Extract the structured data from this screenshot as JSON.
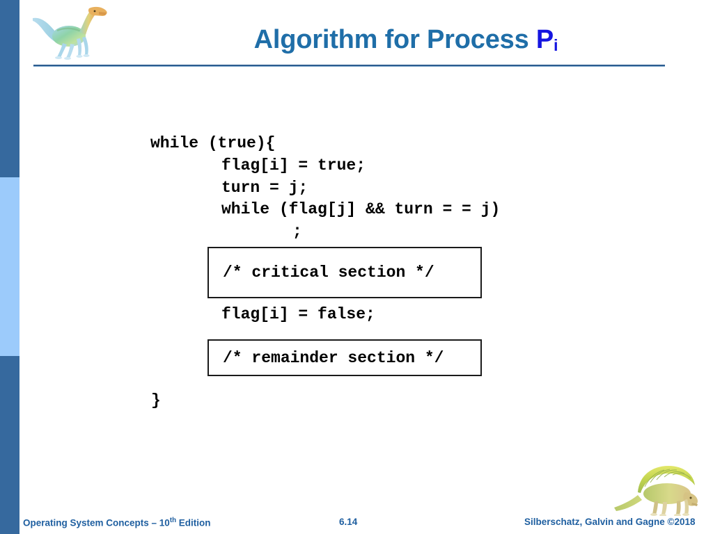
{
  "slide": {
    "title_main": "Algorithm for Process ",
    "title_var": "P",
    "title_var_sub": "i",
    "title_color": "#1f6ea8",
    "title_var_color": "#1515e0",
    "rule_color": "#2c5d8f"
  },
  "sidebar": {
    "segments": [
      {
        "name": "top",
        "color": "#36699e"
      },
      {
        "name": "middle",
        "color": "#9ccbfb"
      },
      {
        "name": "bottom",
        "color": "#36699e"
      }
    ]
  },
  "decorations": {
    "top_dinosaur": "ornithomimid-dinosaur-illustration",
    "bottom_dinosaur": "dimetrodon-dinosaur-illustration"
  },
  "code": {
    "line_while_true": "while (true){",
    "line_flag_true": "flag[i] = true;",
    "line_turn_j": "turn = j;",
    "line_while_flagj": "while (flag[j] && turn = = j)",
    "line_semicolon": ";",
    "line_flag_false": "flag[i] = false;",
    "line_close_brace": "}"
  },
  "boxes": {
    "critical_section": "/* critical section */",
    "remainder_section": "/* remainder section */"
  },
  "footer": {
    "left_prefix": "Operating System Concepts – 10",
    "left_sup": "th",
    "left_suffix": " Edition",
    "slide_number": "6.14",
    "right": "Silberschatz, Galvin and Gagne ©2018",
    "color": "#1f5fa0"
  }
}
